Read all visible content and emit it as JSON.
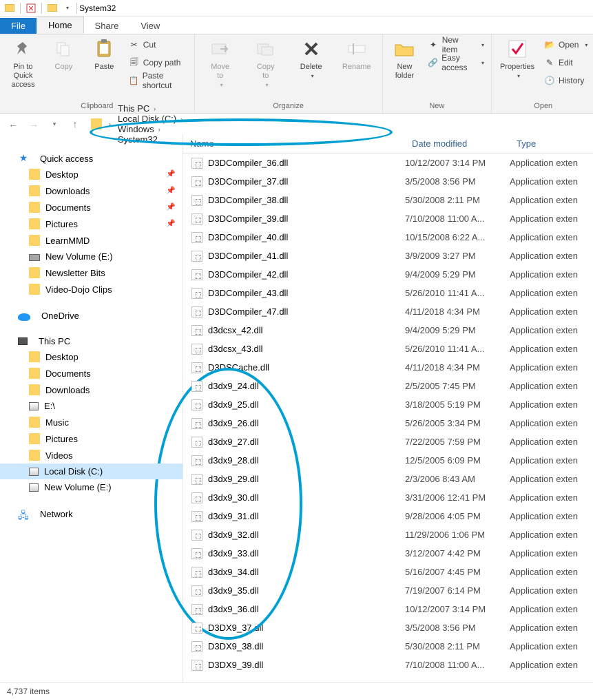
{
  "window": {
    "title": "System32"
  },
  "tabs": {
    "file": "File",
    "home": "Home",
    "share": "Share",
    "view": "View"
  },
  "ribbon": {
    "clipboard": {
      "pin": "Pin to Quick\naccess",
      "copy": "Copy",
      "paste": "Paste",
      "cut": "Cut",
      "copy_path": "Copy path",
      "paste_shortcut": "Paste shortcut",
      "label": "Clipboard"
    },
    "organize": {
      "move_to": "Move\nto",
      "copy_to": "Copy\nto",
      "delete": "Delete",
      "rename": "Rename",
      "label": "Organize"
    },
    "new": {
      "new_folder": "New\nfolder",
      "new_item": "New item",
      "easy_access": "Easy access",
      "label": "New"
    },
    "open": {
      "properties": "Properties",
      "open": "Open",
      "edit": "Edit",
      "history": "History",
      "label": "Open"
    }
  },
  "breadcrumbs": [
    "This PC",
    "Local Disk (C:)",
    "Windows",
    "System32"
  ],
  "columns": {
    "name": "Name",
    "date": "Date modified",
    "type": "Type"
  },
  "type_label": "Application exten",
  "nav": {
    "quick_access": "Quick access",
    "qa_items": [
      {
        "label": "Desktop",
        "pinned": true
      },
      {
        "label": "Downloads",
        "pinned": true
      },
      {
        "label": "Documents",
        "pinned": true
      },
      {
        "label": "Pictures",
        "pinned": true
      },
      {
        "label": "LearnMMD",
        "pinned": false
      },
      {
        "label": "New Volume (E:)",
        "pinned": false
      },
      {
        "label": "Newsletter Bits",
        "pinned": false
      },
      {
        "label": "Video-Dojo Clips",
        "pinned": false
      }
    ],
    "onedrive": "OneDrive",
    "this_pc": "This PC",
    "pc_items": [
      {
        "label": "Desktop"
      },
      {
        "label": "Documents"
      },
      {
        "label": "Downloads"
      },
      {
        "label": "E:\\"
      },
      {
        "label": "Music"
      },
      {
        "label": "Pictures"
      },
      {
        "label": "Videos"
      },
      {
        "label": "Local Disk (C:)",
        "selected": true
      },
      {
        "label": "New Volume (E:)"
      }
    ],
    "network": "Network"
  },
  "files": [
    {
      "name": "D3DCompiler_36.dll",
      "date": "10/12/2007 3:14 PM"
    },
    {
      "name": "D3DCompiler_37.dll",
      "date": "3/5/2008 3:56 PM"
    },
    {
      "name": "D3DCompiler_38.dll",
      "date": "5/30/2008 2:11 PM"
    },
    {
      "name": "D3DCompiler_39.dll",
      "date": "7/10/2008 11:00 A..."
    },
    {
      "name": "D3DCompiler_40.dll",
      "date": "10/15/2008 6:22 A..."
    },
    {
      "name": "D3DCompiler_41.dll",
      "date": "3/9/2009 3:27 PM"
    },
    {
      "name": "D3DCompiler_42.dll",
      "date": "9/4/2009 5:29 PM"
    },
    {
      "name": "D3DCompiler_43.dll",
      "date": "5/26/2010 11:41 A..."
    },
    {
      "name": "D3DCompiler_47.dll",
      "date": "4/11/2018 4:34 PM"
    },
    {
      "name": "d3dcsx_42.dll",
      "date": "9/4/2009 5:29 PM"
    },
    {
      "name": "d3dcsx_43.dll",
      "date": "5/26/2010 11:41 A..."
    },
    {
      "name": "D3DSCache.dll",
      "date": "4/11/2018 4:34 PM"
    },
    {
      "name": "d3dx9_24.dll",
      "date": "2/5/2005 7:45 PM"
    },
    {
      "name": "d3dx9_25.dll",
      "date": "3/18/2005 5:19 PM"
    },
    {
      "name": "d3dx9_26.dll",
      "date": "5/26/2005 3:34 PM"
    },
    {
      "name": "d3dx9_27.dll",
      "date": "7/22/2005 7:59 PM"
    },
    {
      "name": "d3dx9_28.dll",
      "date": "12/5/2005 6:09 PM"
    },
    {
      "name": "d3dx9_29.dll",
      "date": "2/3/2006 8:43 AM"
    },
    {
      "name": "d3dx9_30.dll",
      "date": "3/31/2006 12:41 PM"
    },
    {
      "name": "d3dx9_31.dll",
      "date": "9/28/2006 4:05 PM"
    },
    {
      "name": "d3dx9_32.dll",
      "date": "11/29/2006 1:06 PM"
    },
    {
      "name": "d3dx9_33.dll",
      "date": "3/12/2007 4:42 PM"
    },
    {
      "name": "d3dx9_34.dll",
      "date": "5/16/2007 4:45 PM"
    },
    {
      "name": "d3dx9_35.dll",
      "date": "7/19/2007 6:14 PM"
    },
    {
      "name": "d3dx9_36.dll",
      "date": "10/12/2007 3:14 PM"
    },
    {
      "name": "D3DX9_37.dll",
      "date": "3/5/2008 3:56 PM"
    },
    {
      "name": "D3DX9_38.dll",
      "date": "5/30/2008 2:11 PM"
    },
    {
      "name": "D3DX9_39.dll",
      "date": "7/10/2008 11:00 A..."
    }
  ],
  "status": {
    "count": "4,737 items"
  }
}
